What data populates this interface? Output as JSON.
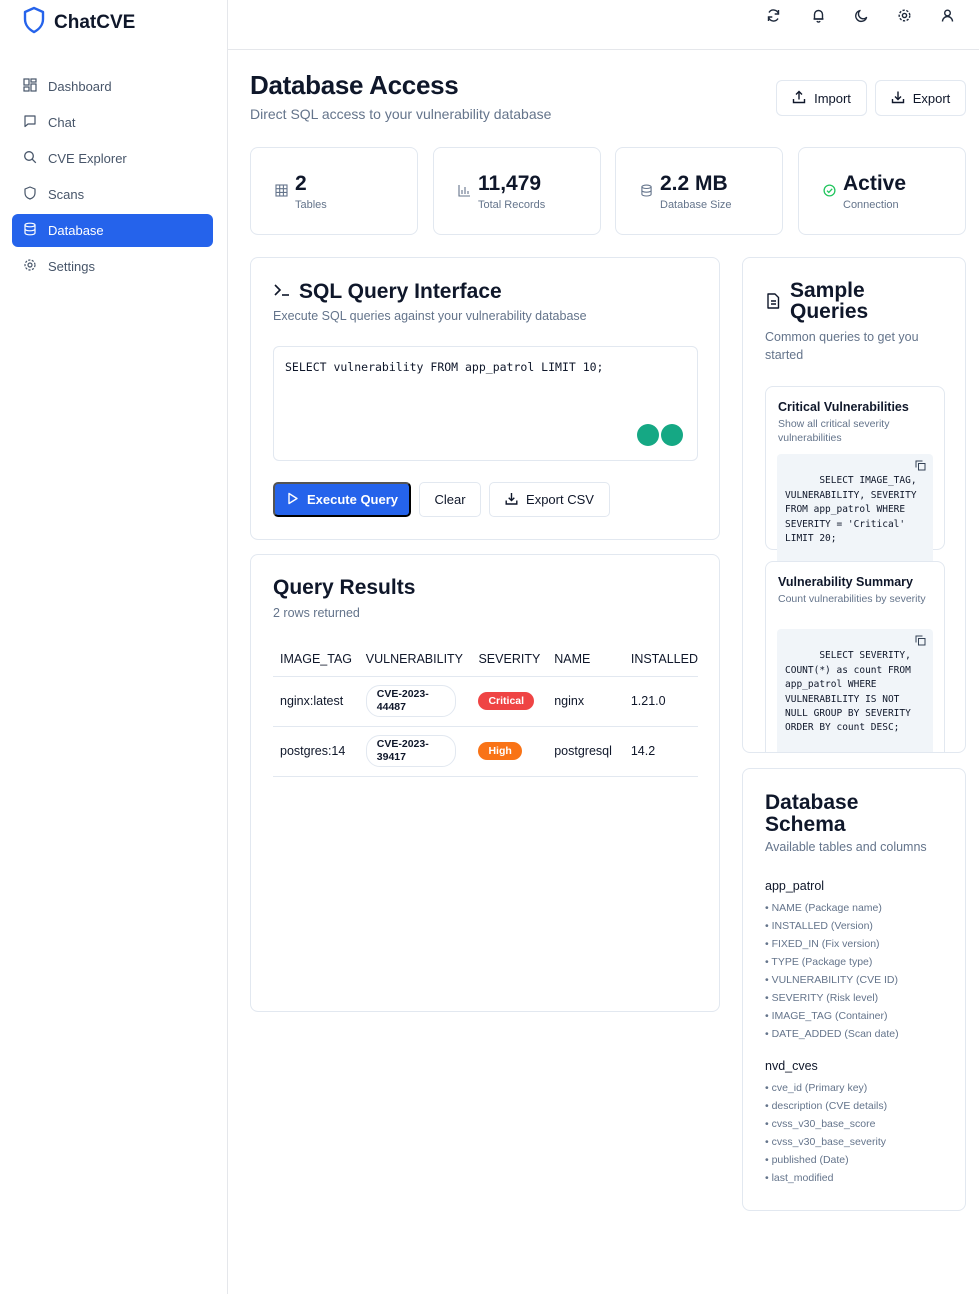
{
  "brand": {
    "name": "ChatCVE"
  },
  "sidebar": {
    "items": [
      {
        "label": "Dashboard",
        "icon": "dashboard-icon",
        "active": false
      },
      {
        "label": "Chat",
        "icon": "chat-icon",
        "active": false
      },
      {
        "label": "CVE Explorer",
        "icon": "search-icon",
        "active": false
      },
      {
        "label": "Scans",
        "icon": "shield-icon",
        "active": false
      },
      {
        "label": "Database",
        "icon": "database-icon",
        "active": true
      },
      {
        "label": "Settings",
        "icon": "gear-icon",
        "active": false
      }
    ]
  },
  "topbar": {
    "icons": [
      "refresh-icon",
      "bell-icon",
      "moon-icon",
      "gear-icon",
      "user-icon"
    ]
  },
  "header": {
    "title": "Database Access",
    "subtitle": "Direct SQL access to your vulnerability database",
    "import_label": "Import",
    "export_label": "Export"
  },
  "stats": [
    {
      "value": "2",
      "label": "Tables",
      "icon": "table-icon"
    },
    {
      "value": "11,479",
      "label": "Total Records",
      "icon": "bar-chart-icon"
    },
    {
      "value": "2.2 MB",
      "label": "Database Size",
      "icon": "database-icon"
    },
    {
      "value": "Active",
      "label": "Connection",
      "icon": "check-circle-icon"
    }
  ],
  "query": {
    "title": "SQL Query Interface",
    "subtitle": "Execute SQL queries against your vulnerability database",
    "sql": "SELECT vulnerability FROM app_patrol LIMIT 10;",
    "execute_label": "Execute Query",
    "clear_label": "Clear",
    "export_csv_label": "Export CSV"
  },
  "results": {
    "title": "Query Results",
    "subtitle": "2 rows returned",
    "columns": [
      "IMAGE_TAG",
      "VULNERABILITY",
      "SEVERITY",
      "NAME",
      "INSTALLED"
    ],
    "rows": [
      {
        "image_tag": "nginx:latest",
        "vulnerability": "CVE-2023-44487",
        "severity": "Critical",
        "name": "nginx",
        "installed": "1.21.0"
      },
      {
        "image_tag": "postgres:14",
        "vulnerability": "CVE-2023-39417",
        "severity": "High",
        "name": "postgresql",
        "installed": "14.2"
      }
    ],
    "severity_colors": {
      "Critical": "#ef4444",
      "High": "#f97316"
    }
  },
  "samples": {
    "title_line1": "Sample",
    "title_line2": "Queries",
    "subtitle": "Common queries to get you started",
    "items": [
      {
        "title": "Critical Vulnerabilities",
        "description": "Show all critical severity vulnerabilities",
        "code": "SELECT IMAGE_TAG,\nVULNERABILITY, SEVERITY\nFROM app_patrol WHERE\nSEVERITY = 'Critical'\nLIMIT 20;"
      },
      {
        "title": "Vulnerability Summary",
        "description": "Count vulnerabilities by severity",
        "code": "SELECT SEVERITY,\nCOUNT(*) as count FROM\napp_patrol WHERE\nVULNERABILITY IS NOT\nNULL GROUP BY SEVERITY\nORDER BY count DESC;"
      }
    ]
  },
  "schema": {
    "title_line1": "Database",
    "title_line2": "Schema",
    "subtitle": "Available tables and columns",
    "tables": [
      {
        "name": "app_patrol",
        "columns": [
          "• NAME (Package name)",
          "• INSTALLED (Version)",
          "• FIXED_IN (Fix version)",
          "• TYPE (Package type)",
          "• VULNERABILITY (CVE ID)",
          "• SEVERITY (Risk level)",
          "• IMAGE_TAG (Container)",
          "• DATE_ADDED (Scan date)"
        ]
      },
      {
        "name": "nvd_cves",
        "columns": [
          "• cve_id (Primary key)",
          "• description (CVE details)",
          "• cvss_v30_base_score",
          "• cvss_v30_base_severity",
          "• published (Date)",
          "• last_modified"
        ]
      }
    ]
  },
  "colors": {
    "accent": "#2563eb",
    "border": "#e2e8f0",
    "muted": "#64748b",
    "success": "#22c55e"
  }
}
